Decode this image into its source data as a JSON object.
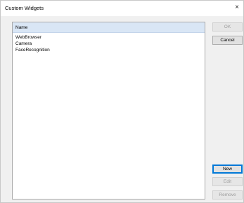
{
  "window": {
    "title": "Custom Widgets",
    "close_glyph": "×"
  },
  "list": {
    "header": "Name",
    "items": [
      {
        "label": "WebBrowser"
      },
      {
        "label": "Camera"
      },
      {
        "label": "FaceRecognition"
      }
    ]
  },
  "buttons": {
    "ok": {
      "label": "OK",
      "enabled": false
    },
    "cancel": {
      "label": "Cancel",
      "enabled": true
    },
    "new": {
      "label": "New",
      "enabled": true,
      "focused": true
    },
    "edit": {
      "label": "Edit",
      "enabled": false
    },
    "remove": {
      "label": "Remove",
      "enabled": false
    }
  },
  "colors": {
    "header_background": "#d9e6f5",
    "focus_border": "#0078d7",
    "disabled_text": "#9c9c9c"
  }
}
